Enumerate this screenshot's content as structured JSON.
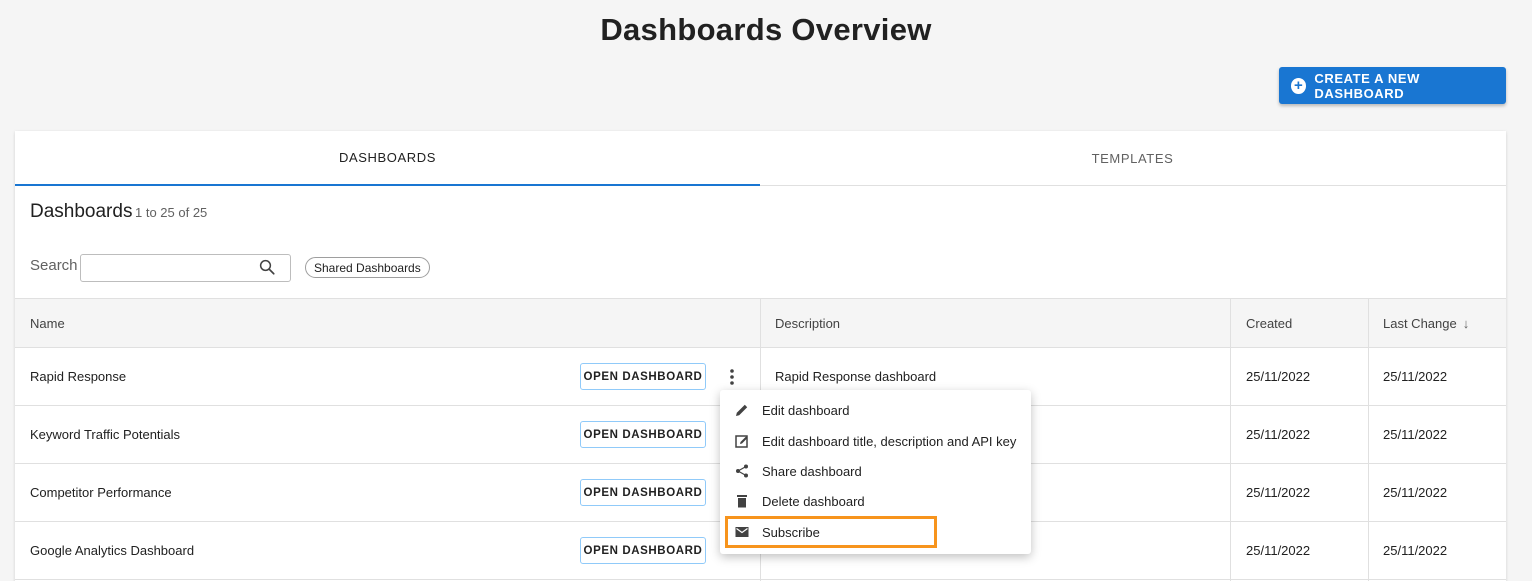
{
  "page": {
    "title": "Dashboards Overview",
    "create_button": "CREATE A NEW DASHBOARD"
  },
  "tabs": [
    {
      "label": "DASHBOARDS",
      "active": true
    },
    {
      "label": "TEMPLATES",
      "active": false
    }
  ],
  "section": {
    "title": "Dashboards",
    "count": "1 to 25 of 25"
  },
  "search": {
    "label": "Search",
    "value": "",
    "placeholder": ""
  },
  "filter_chip": "Shared Dashboards",
  "columns": {
    "name": "Name",
    "description": "Description",
    "created": "Created",
    "last_change": "Last Change"
  },
  "open_label": "OPEN DASHBOARD",
  "rows": [
    {
      "name": "Rapid Response",
      "description": "Rapid Response dashboard",
      "created": "25/11/2022",
      "last_change": "25/11/2022"
    },
    {
      "name": "Keyword Traffic Potentials",
      "description": "",
      "created": "25/11/2022",
      "last_change": "25/11/2022"
    },
    {
      "name": "Competitor Performance",
      "description": "",
      "created": "25/11/2022",
      "last_change": "25/11/2022"
    },
    {
      "name": "Google Analytics Dashboard",
      "description": "",
      "created": "25/11/2022",
      "last_change": "25/11/2022"
    }
  ],
  "menu": {
    "items": [
      {
        "label": "Edit dashboard",
        "icon": "pencil-icon"
      },
      {
        "label": "Edit dashboard title, description and API key",
        "icon": "edit-box-icon"
      },
      {
        "label": "Share dashboard",
        "icon": "share-icon"
      },
      {
        "label": "Delete dashboard",
        "icon": "trash-icon"
      },
      {
        "label": "Subscribe",
        "icon": "mail-icon"
      }
    ],
    "highlighted_item": "Subscribe"
  },
  "colors": {
    "accent": "#1976d2",
    "highlight": "#f7941d"
  }
}
